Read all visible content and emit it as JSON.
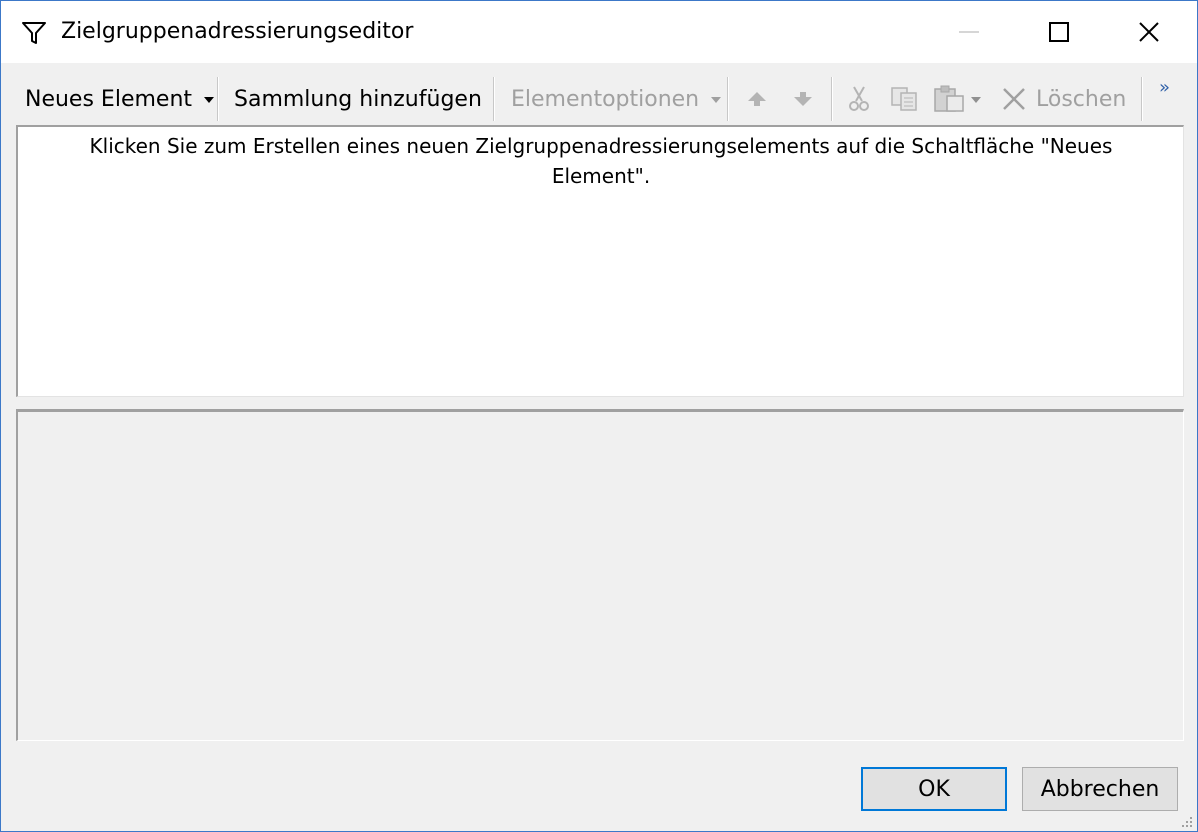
{
  "window": {
    "title": "Zielgruppenadressierungseditor"
  },
  "toolbar": {
    "new_element": "Neues Element",
    "add_collection": "Sammlung hinzufügen",
    "element_options": "Elementoptionen",
    "delete": "Löschen",
    "overflow": "»"
  },
  "editor": {
    "hint": "Klicken Sie zum Erstellen eines neuen Zielgruppenadressierungselements auf die Schaltfläche \"Neues Element\"."
  },
  "footer": {
    "ok": "OK",
    "cancel": "Abbrechen"
  },
  "colors": {
    "accent": "#0078d7",
    "window_border": "#3c78c8",
    "disabled_text": "#a0a0a0"
  }
}
